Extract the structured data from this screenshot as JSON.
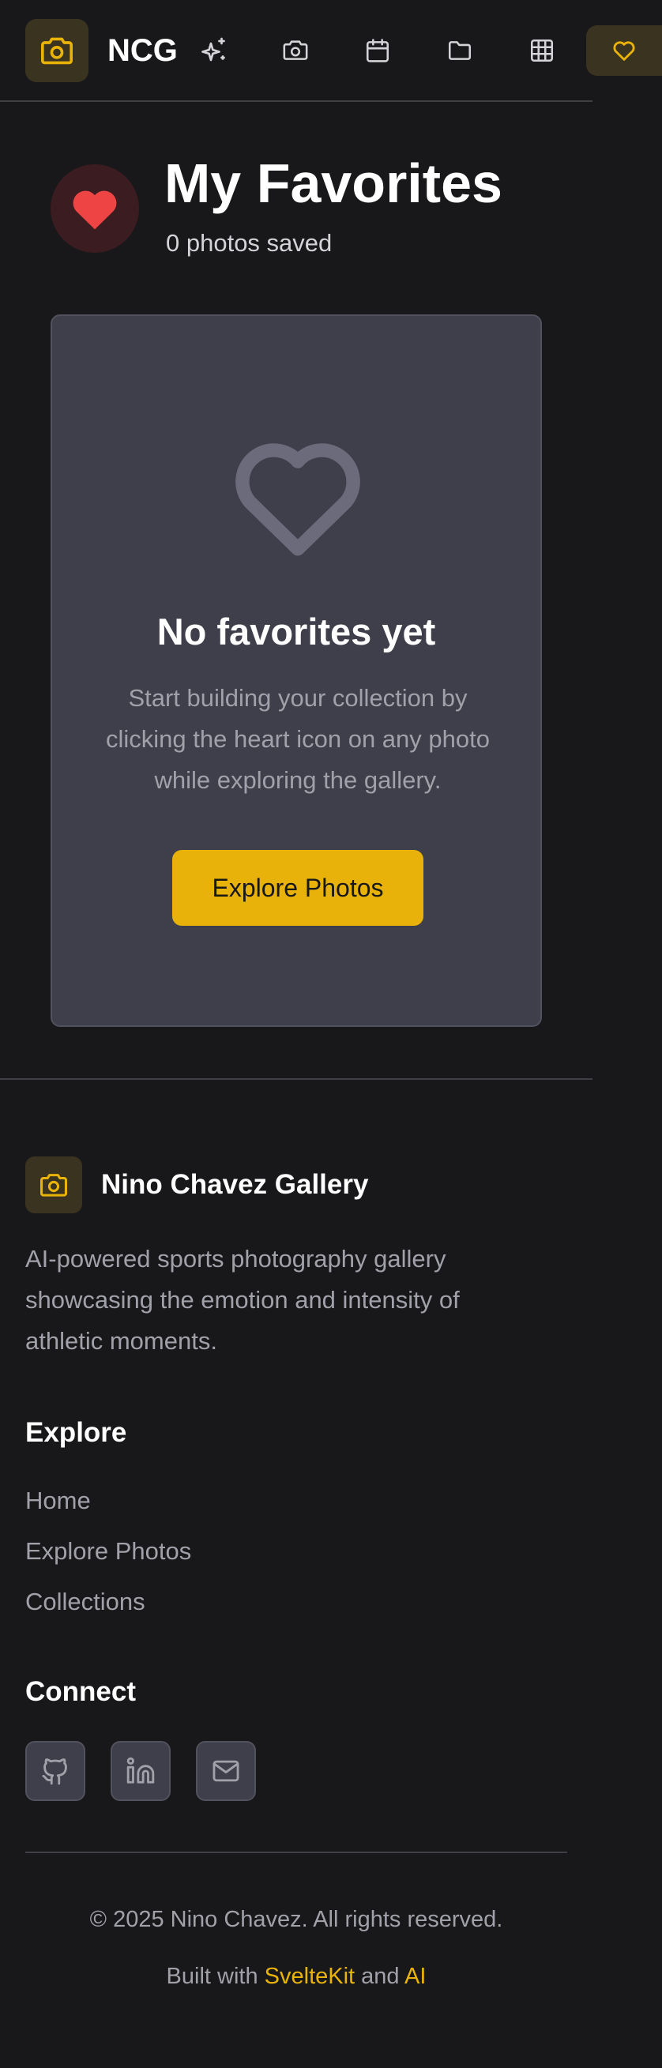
{
  "header": {
    "brand": "NCG",
    "nav_icons": [
      "sparkles-icon",
      "camera-icon",
      "calendar-icon",
      "folder-icon",
      "grid-icon",
      "heart-icon"
    ],
    "active_nav": "heart-icon"
  },
  "page": {
    "title": "My Favorites",
    "subtitle": "0 photos saved"
  },
  "empty_state": {
    "title": "No favorites yet",
    "text": "Start building your collection by clicking the heart icon on any photo while exploring the gallery.",
    "button_label": "Explore Photos"
  },
  "footer": {
    "brand": "Nino Chavez Gallery",
    "description": "AI-powered sports photography gallery showcasing the emotion and intensity of athletic moments.",
    "explore_heading": "Explore",
    "explore_links": [
      "Home",
      "Explore Photos",
      "Collections"
    ],
    "connect_heading": "Connect",
    "social_icons": [
      "github-icon",
      "linkedin-icon",
      "mail-icon"
    ],
    "copyright": "© 2025 Nino Chavez. All rights reserved.",
    "built_prefix": "Built with",
    "built_sveltekit": "SvelteKit",
    "built_and": "and",
    "built_ai": "AI"
  },
  "colors": {
    "background": "#18181b",
    "accent": "#eab308",
    "heart_red": "#ef4444",
    "card": "#3f3f4c"
  }
}
